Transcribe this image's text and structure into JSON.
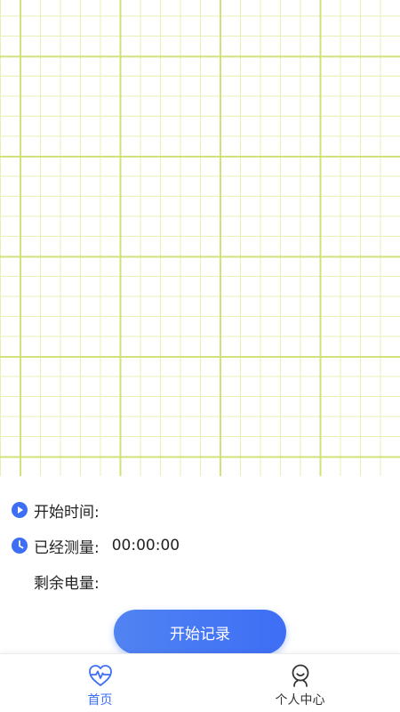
{
  "colors": {
    "accent": "#3d6ef5",
    "grid_major": "#d2e27a",
    "grid_minor": "#e9f0b6",
    "text": "#222222"
  },
  "info": {
    "start_time_label": "开始时间:",
    "start_time_value": "",
    "measured_label": "已经测量:",
    "measured_value": "00:00:00",
    "battery_label": "剩余电量:",
    "battery_value": ""
  },
  "actions": {
    "start_record_label": "开始记录"
  },
  "tabs": [
    {
      "label": "首页",
      "icon": "heart-pulse-icon",
      "active": true
    },
    {
      "label": "个人中心",
      "icon": "person-smile-icon",
      "active": false
    }
  ]
}
